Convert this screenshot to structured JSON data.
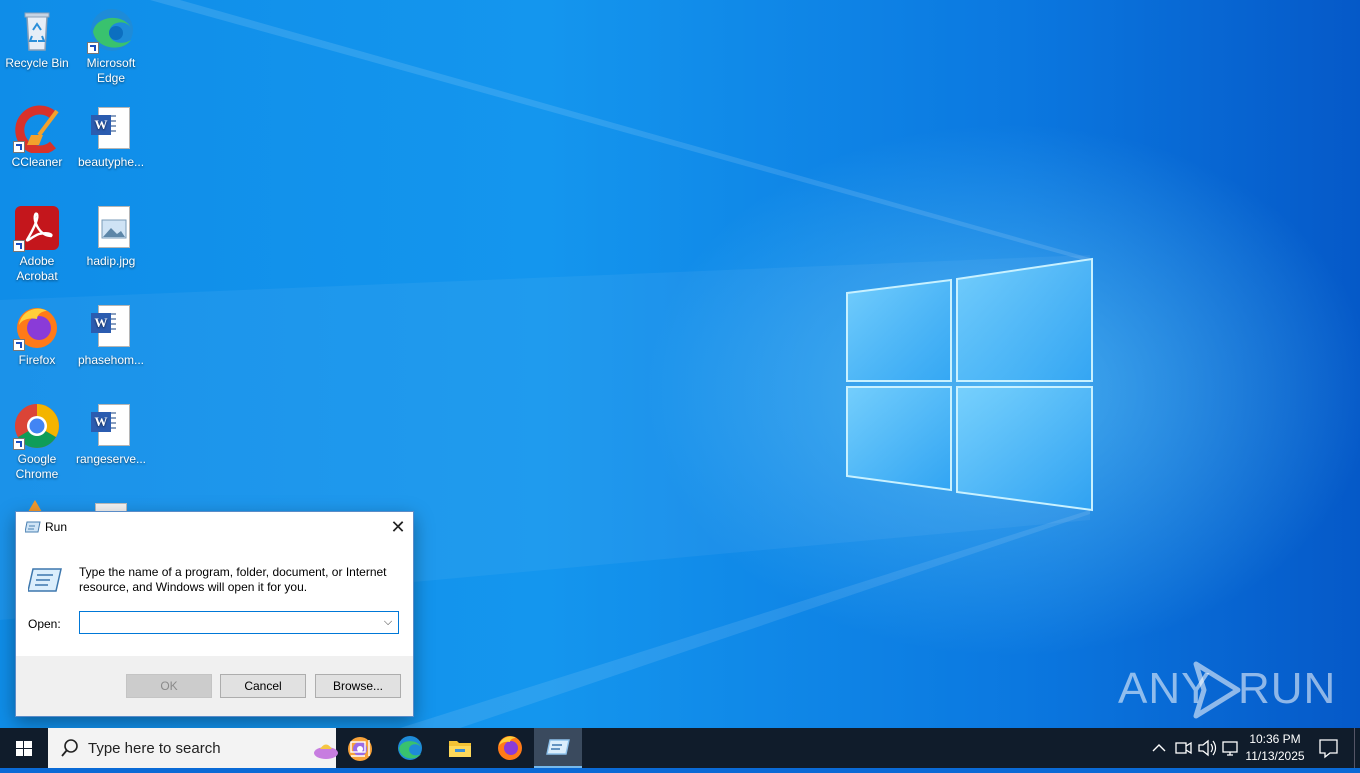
{
  "desktop": {
    "icons": [
      {
        "label": "Recycle Bin",
        "icon": "recycle-bin-icon"
      },
      {
        "label": "Microsoft Edge",
        "icon": "edge-icon"
      },
      {
        "label": "CCleaner",
        "icon": "ccleaner-icon"
      },
      {
        "label": "beautyphe...",
        "icon": "word-document-icon"
      },
      {
        "label": "Adobe Acrobat",
        "icon": "adobe-acrobat-icon"
      },
      {
        "label": "hadip.jpg",
        "icon": "image-file-icon"
      },
      {
        "label": "Firefox",
        "icon": "firefox-icon"
      },
      {
        "label": "phasehom...",
        "icon": "word-document-icon"
      },
      {
        "label": "Google Chrome",
        "icon": "chrome-icon"
      },
      {
        "label": "rangeserve...",
        "icon": "word-document-icon"
      }
    ]
  },
  "run_dialog": {
    "title": "Run",
    "description": "Type the name of a program, folder, document, or Internet resource, and Windows will open it for you.",
    "open_label": "Open:",
    "open_value": "",
    "ok_label": "OK",
    "cancel_label": "Cancel",
    "browse_label": "Browse...",
    "close_glyph": "✕"
  },
  "watermark": {
    "left": "ANY",
    "right": "RUN"
  },
  "taskbar": {
    "search_placeholder": "Type here to search",
    "pinned": [
      "task-view-icon",
      "edge-icon",
      "file-explorer-icon",
      "firefox-icon",
      "run-icon"
    ],
    "clock_time": "10:36 PM",
    "clock_date": "11/13/2025"
  },
  "colors": {
    "accent": "#0078d7",
    "taskbar": "#101c2b",
    "desktop": "#0f8de8"
  }
}
